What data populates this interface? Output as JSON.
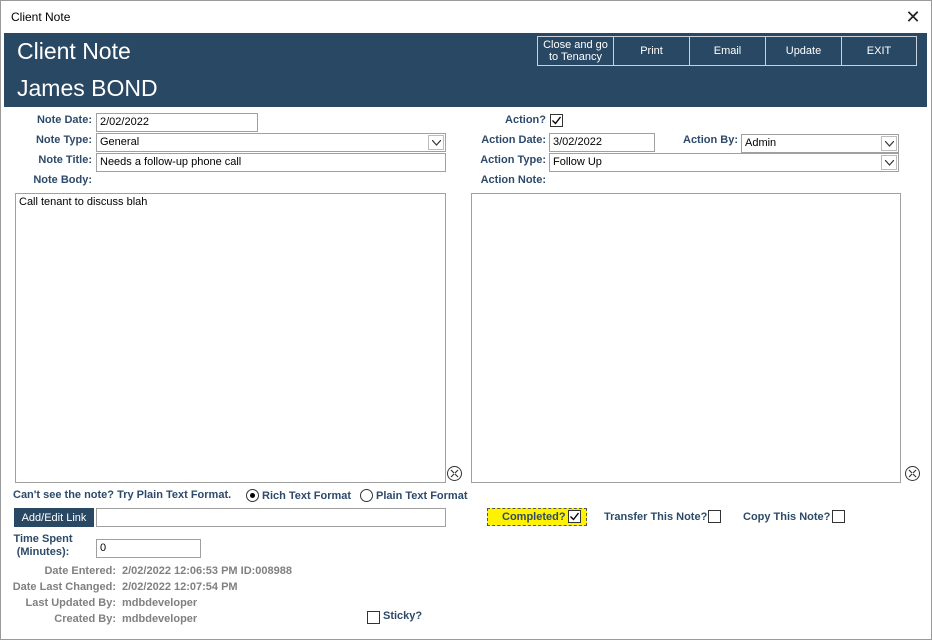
{
  "window": {
    "title": "Client Note"
  },
  "header": {
    "title": "Client Note",
    "client_name": "James BOND",
    "buttons": {
      "close_tenancy_line1": "Close and go",
      "close_tenancy_line2": "to Tenancy",
      "print": "Print",
      "email": "Email",
      "update": "Update",
      "exit": "EXIT"
    }
  },
  "form": {
    "note_date_label": "Note Date:",
    "note_date": "2/02/2022",
    "note_type_label": "Note Type:",
    "note_type": "General",
    "note_title_label": "Note Title:",
    "note_title": "Needs a follow-up phone call",
    "note_body_label": "Note Body:",
    "note_body": "Call tenant to discuss blah",
    "action_label": "Action?",
    "action_checked": true,
    "action_date_label": "Action Date:",
    "action_date": "3/02/2022",
    "action_by_label": "Action By:",
    "action_by": "Admin",
    "action_type_label": "Action Type:",
    "action_type": "Follow Up",
    "action_note_label": "Action Note:",
    "action_note": "",
    "format_hint": "Can't see the note? Try Plain Text Format.",
    "rich_text_label": "Rich Text Format",
    "plain_text_label": "Plain Text Format",
    "format_selected": "Rich Text Format",
    "add_link_label": "Add/Edit Link",
    "link_value": "",
    "completed_label": "Completed?",
    "completed_checked": true,
    "transfer_label": "Transfer This Note?",
    "copy_label": "Copy This Note?",
    "time_spent_label_line1": "Time Spent",
    "time_spent_label_line2": "(Minutes):",
    "time_spent": "0",
    "date_entered_label": "Date Entered:",
    "date_entered": "2/02/2022 12:06:53 PM ID:008988",
    "date_changed_label": "Date Last Changed:",
    "date_changed": "2/02/2022 12:07:54 PM",
    "last_updated_label": "Last Updated By:",
    "last_updated": "mdbdeveloper",
    "created_by_label": "Created By:",
    "created_by": "mdbdeveloper",
    "sticky_label": "Sticky?"
  },
  "colors": {
    "header_bg": "#294864",
    "label": "#2d4a6a",
    "completed_highlight": "#fff200"
  },
  "icons": [
    "close-icon",
    "dropdown-arrow-icon",
    "checkmark-icon",
    "expand-zoom-icon"
  ]
}
